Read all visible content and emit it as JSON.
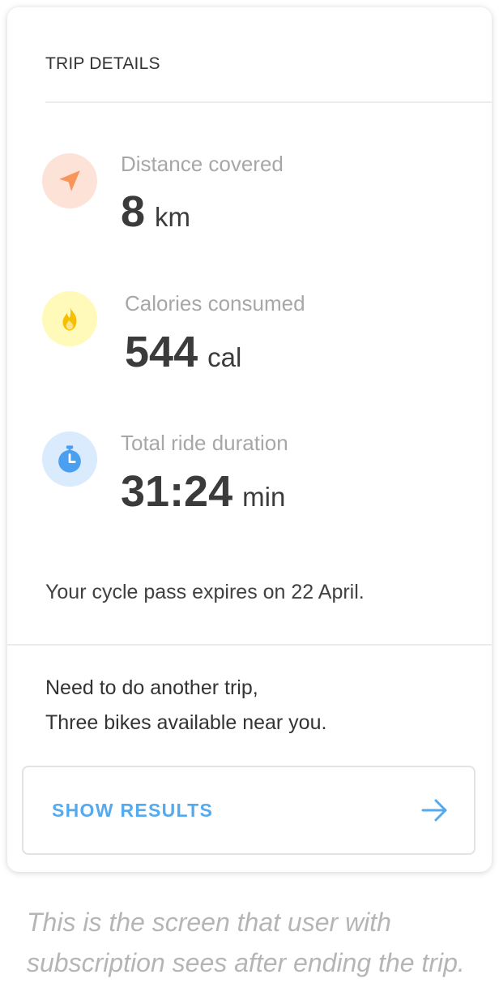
{
  "card": {
    "section_title": "TRIP DETAILS",
    "stats": [
      {
        "icon": "navigation-arrow-icon",
        "label": "Distance covered",
        "value": "8",
        "unit": "km",
        "icon_color": "#f7955a",
        "icon_bg": "#fde3d7"
      },
      {
        "icon": "flame-icon",
        "label": "Calories consumed",
        "value": "544",
        "unit": "cal",
        "icon_color": "#f6c000",
        "icon_bg": "#fffaba"
      },
      {
        "icon": "stopwatch-icon",
        "label": "Total ride duration",
        "value": "31:24",
        "unit": "min",
        "icon_color": "#4a9ff0",
        "icon_bg": "#d9ebfd"
      }
    ],
    "pass_notice": "Your cycle pass expires on 22 April.",
    "promo": {
      "line1": "Need to do another trip,",
      "line2": "Three bikes available near you."
    },
    "button": {
      "label": "SHOW RESULTS",
      "icon": "arrow-right-icon",
      "color": "#55aaee"
    }
  },
  "caption": {
    "line1": "This is the screen that user with",
    "line2": "subscription sees after ending the trip."
  }
}
